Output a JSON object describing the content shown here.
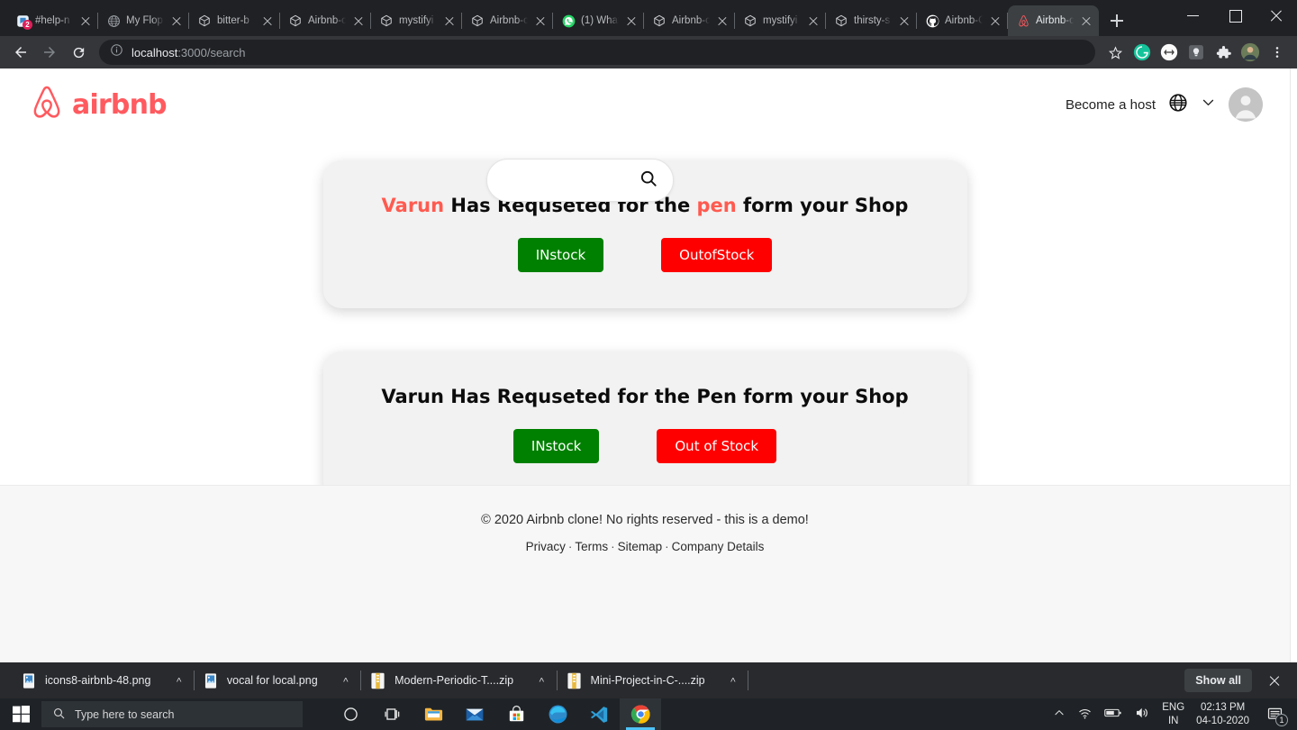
{
  "browser": {
    "tabs": [
      {
        "title": "#help-n",
        "favicon": "slack-icon",
        "badge": "2",
        "active": false
      },
      {
        "title": "My Flop",
        "favicon": "globe-icon",
        "active": false
      },
      {
        "title": "bitter-b",
        "favicon": "codesandbox-icon",
        "active": false
      },
      {
        "title": "Airbnb-c",
        "favicon": "codesandbox-icon",
        "active": false
      },
      {
        "title": "mystifyi",
        "favicon": "codesandbox-icon",
        "active": false
      },
      {
        "title": "Airbnb-c",
        "favicon": "codesandbox-icon",
        "active": false
      },
      {
        "title": "(1) What",
        "favicon": "whatsapp-icon",
        "active": false
      },
      {
        "title": "Airbnb-c",
        "favicon": "codesandbox-icon",
        "active": false
      },
      {
        "title": "mystifyi",
        "favicon": "codesandbox-icon",
        "active": false
      },
      {
        "title": "thirsty-s",
        "favicon": "codesandbox-icon",
        "active": false
      },
      {
        "title": "Airbnb-C",
        "favicon": "github-icon",
        "active": false
      },
      {
        "title": "Airbnb-c",
        "favicon": "airbnb-icon",
        "active": true
      }
    ],
    "new_tab_label": "+",
    "window_controls": {
      "minimize": "minimize-icon",
      "maximize": "maximize-icon",
      "close": "close-icon"
    },
    "toolbar": {
      "back": "back-arrow-icon",
      "forward": "forward-arrow-icon",
      "reload": "reload-icon",
      "site_info": "info-circle-icon",
      "url_host": "localhost",
      "url_rest": ":3000/search",
      "bookmark": "star-icon",
      "extensions": [
        {
          "name": "grammarly-icon",
          "color": "#15c39a"
        },
        {
          "name": "extension-circle-icon",
          "color": "#ffffff"
        },
        {
          "name": "lightbulb-icon",
          "color": "#5f6368"
        },
        {
          "name": "puzzle-icon",
          "color": "#e8eaed"
        }
      ],
      "profile": "profile-avatar",
      "menu": "three-dot-menu-icon"
    }
  },
  "site": {
    "brand": {
      "wordmark": "airbnb",
      "logo": "airbnb-belo-icon",
      "color": "#FF5A5F"
    },
    "search": {
      "value": "",
      "placeholder": "",
      "icon": "search-icon"
    },
    "header_right": {
      "become_host": "Become a host",
      "language_icon": "globe-icon",
      "chevron_icon": "chevron-down-icon",
      "avatar_icon": "user-avatar-icon"
    },
    "cards": [
      {
        "title_parts": [
          {
            "text": "Varun",
            "highlight": true
          },
          {
            "text": " Has Requseted for the ",
            "highlight": false
          },
          {
            "text": "pen",
            "highlight": true
          },
          {
            "text": " form your Shop",
            "highlight": false
          }
        ],
        "plain_title": "Varun Has Requseted for the pen form your Shop",
        "in_stock_label": "INstock",
        "out_of_stock_label": "OutofStock"
      },
      {
        "title_parts": [
          {
            "text": "Varun Has Requseted for the Pen form your Shop",
            "highlight": false
          }
        ],
        "plain_title": "Varun Has Requseted for the Pen form your Shop",
        "in_stock_label": "INstock",
        "out_of_stock_label": "Out of Stock"
      }
    ],
    "footer": {
      "copyright": "© 2020 Airbnb clone! No rights reserved - this is a demo!",
      "links": [
        "Privacy",
        "Terms",
        "Sitemap",
        "Company Details"
      ],
      "separator": "·"
    }
  },
  "downloads": {
    "items": [
      {
        "filename": "icons8-airbnb-48.png",
        "type": "image",
        "caret": "˄"
      },
      {
        "filename": "vocal for local.png",
        "type": "image",
        "caret": "˄"
      },
      {
        "filename": "Modern-Periodic-T....zip",
        "type": "archive",
        "caret": "˄"
      },
      {
        "filename": "Mini-Project-in-C-....zip",
        "type": "archive",
        "caret": "˄"
      }
    ],
    "show_all_label": "Show all",
    "close_icon": "close-icon"
  },
  "taskbar": {
    "start_icon": "windows-start-icon",
    "search_placeholder": "Type here to search",
    "search_icon": "search-icon",
    "apps": [
      {
        "name": "cortana-icon",
        "active": false
      },
      {
        "name": "task-view-icon",
        "active": false
      },
      {
        "name": "file-explorer-icon",
        "active": false
      },
      {
        "name": "mail-icon",
        "active": false
      },
      {
        "name": "microsoft-store-icon",
        "active": false
      },
      {
        "name": "edge-icon",
        "active": false
      },
      {
        "name": "vscode-icon",
        "active": false
      },
      {
        "name": "chrome-icon",
        "active": true
      }
    ],
    "tray": {
      "overflow_icon": "chevron-up-icon",
      "wifi_icon": "wifi-icon",
      "battery_icon": "battery-icon",
      "volume_icon": "speaker-icon",
      "language_line1": "ENG",
      "language_line2": "IN",
      "time": "02:13 PM",
      "date": "04-10-2020",
      "notification_icon": "notification-icon",
      "notification_count": "1"
    }
  }
}
